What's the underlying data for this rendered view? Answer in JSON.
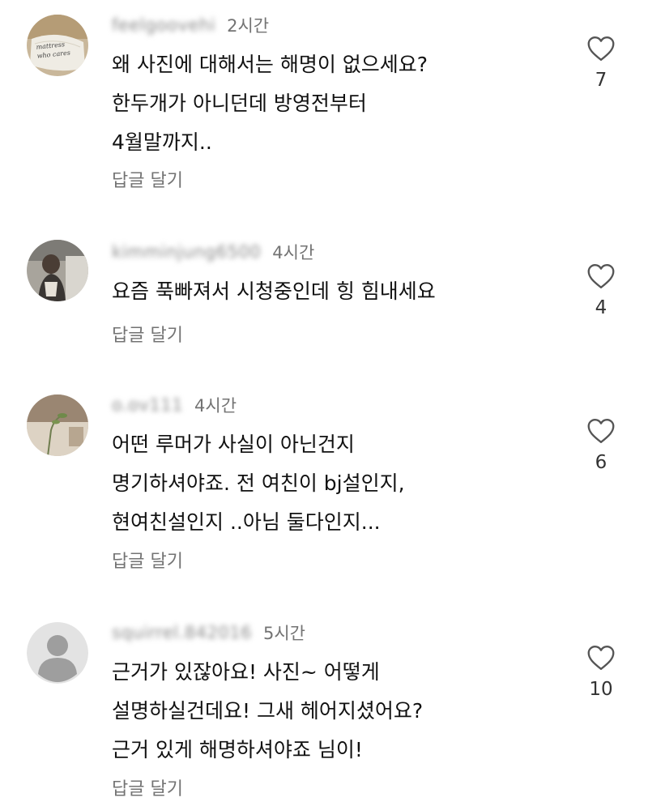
{
  "comments": [
    {
      "username": "feelgoovehi",
      "time": "2시간",
      "text": "왜 사진에 대해서는 해명이 없으세요?\n한두개가 아니던데 방영전부터\n4월말까지..",
      "reply_label": "답글 달기",
      "likes": "7",
      "avatar_text": "mattress who cares"
    },
    {
      "username": "kimminjung6500",
      "time": "4시간",
      "text": "요즘 푹빠져서 시청중인데 힝 힘내세요",
      "reply_label": "답글 달기",
      "likes": "4"
    },
    {
      "username": "o.ov111",
      "time": "4시간",
      "text": "어떤 루머가 사실이 아닌건지\n명기하셔야죠. 전 여친이 bj설인지,\n현여친설인지 ..아님 둘다인지...",
      "reply_label": "답글 달기",
      "likes": "6"
    },
    {
      "username": "squirrel.842016",
      "time": "5시간",
      "text": "근거가 있잖아요! 사진~ 어떻게\n설명하실건데요!  그새 헤어지셨어요?\n근거 있게 해명하셔야죠 님이!",
      "reply_label": "답글 달기",
      "likes": "10"
    }
  ]
}
